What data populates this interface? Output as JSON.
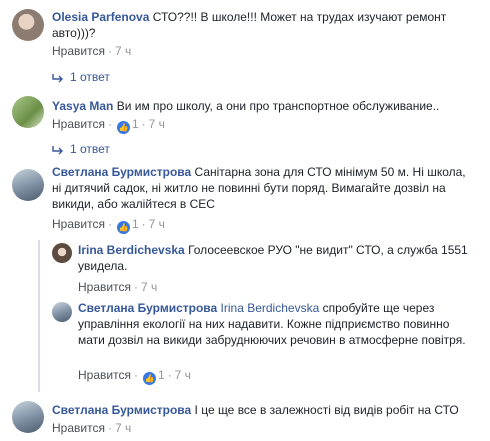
{
  "comments": [
    {
      "author": "Olesia Parfenova",
      "text": "СТО??!! В школе!!! Может на трудах изучают ремонт авто)))?",
      "like_label": "Нравится",
      "time": "7 ч",
      "replies_label": "1 ответ"
    },
    {
      "author": "Yasya Man",
      "text": "Ви им про школу, а они про транспортное обслуживание..",
      "like_label": "Нравится",
      "like_count": "1",
      "time": "7 ч",
      "replies_label": "1 ответ"
    },
    {
      "author": "Светлана Бурмистрова",
      "text": "Санітарна зона для СТО мінімум 50 м. Ні школа, ні дитячий садок, ні житло не повинні бути поряд. Вимагайте дозвіл на викиди, або жалійтеся в СЕС",
      "like_label": "Нравится",
      "like_count": "1",
      "time": "7 ч",
      "replies": [
        {
          "author": "Irina Berdichevska",
          "text": "Голосеевское РУО \"не видит\" СТО, а служба 1551 увидела.",
          "like_label": "Нравится",
          "time": "7 ч"
        },
        {
          "author": "Светлана Бурмистрова",
          "mention": "Irina Berdichevska",
          "text": "спробуйте ще через управління екології на них надавити. Кожне підприємство повинно мати дозвіл на викиди забруднюючих речовин в атмосферне повітря.",
          "like_label": "Нравится",
          "like_count": "1",
          "time": "7 ч"
        }
      ]
    },
    {
      "author": "Светлана Бурмистрова",
      "text": "І це ще все в залежності від видів робіт на СТО",
      "like_label": "Нравится",
      "time": "7 ч"
    }
  ],
  "icons": {
    "like_badge": "thumbs-up-icon",
    "reply_arrow": "reply-arrow-icon"
  },
  "colors": {
    "link": "#365899",
    "meta": "#90949c",
    "like_badge": "#3578e5"
  }
}
